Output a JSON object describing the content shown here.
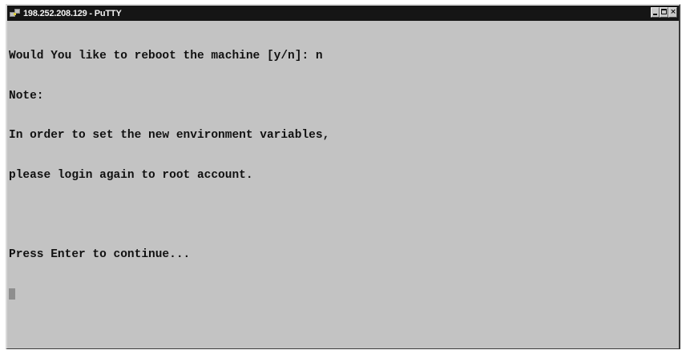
{
  "window": {
    "title": "198.252.208.129 - PuTTY",
    "icon": "putty-icon",
    "controls": {
      "minimize": "minimize-icon",
      "maximize": "maximize-icon",
      "close": "close-icon"
    }
  },
  "terminal": {
    "lines": [
      "Would You like to reboot the machine [y/n]: n",
      "Note:",
      "In order to set the new environment variables,",
      "please login again to root account.",
      "",
      "Press Enter to continue..."
    ]
  },
  "colors": {
    "titlebar": "#151515",
    "terminal_background": "#c3c3c3",
    "terminal_text": "#111111",
    "cursor": "#8e8e8e"
  }
}
